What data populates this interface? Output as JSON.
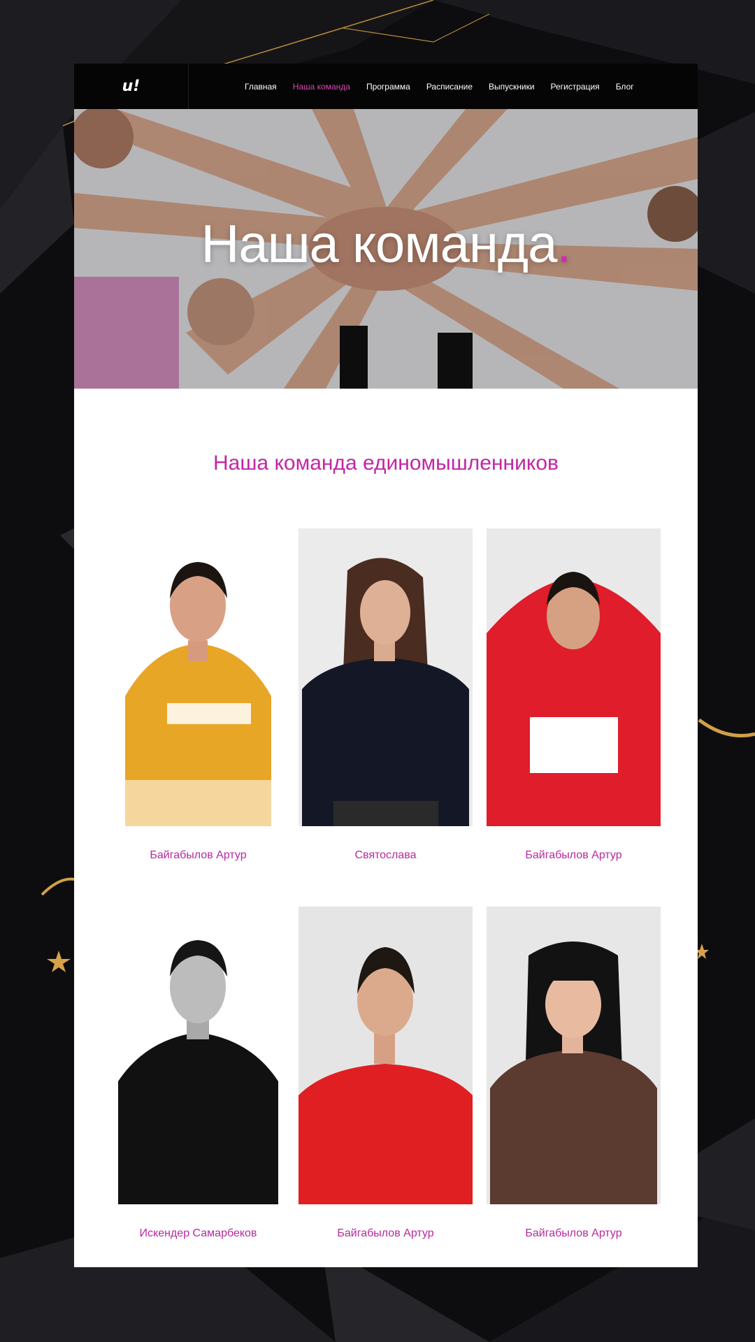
{
  "header": {
    "logo": "u!",
    "nav": [
      {
        "label": "Главная",
        "active": false
      },
      {
        "label": "Наша команда",
        "active": true
      },
      {
        "label": "Программа",
        "active": false
      },
      {
        "label": "Расписание",
        "active": false
      },
      {
        "label": "Выпускники",
        "active": false
      },
      {
        "label": "Регистрация",
        "active": false
      },
      {
        "label": "Блог",
        "active": false
      }
    ]
  },
  "hero": {
    "title": "Наша команда",
    "title_dot": "."
  },
  "team": {
    "title": "Наша команда единомышленников",
    "members": [
      {
        "name": "Байгабылов Артур"
      },
      {
        "name": "Святослава"
      },
      {
        "name": "Байгабылов Артур"
      },
      {
        "name": "Искендер Самарбеков"
      },
      {
        "name": "Байгабылов Артур"
      },
      {
        "name": "Байгабылов Артур"
      }
    ]
  },
  "colors": {
    "accent": "#d946b5",
    "heading": "#c127a6",
    "background": "#0c0c0e"
  }
}
